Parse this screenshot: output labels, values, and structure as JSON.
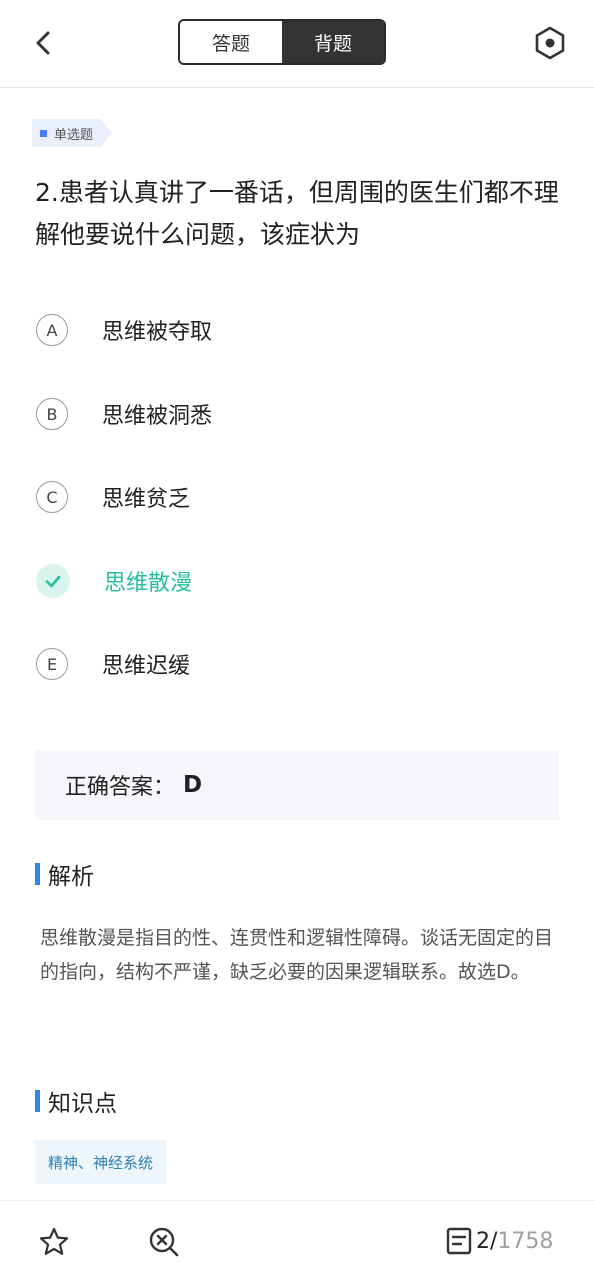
{
  "header": {
    "tabs": [
      {
        "label": "答题",
        "active": false
      },
      {
        "label": "背题",
        "active": true
      }
    ]
  },
  "question": {
    "type_label": "单选题",
    "text": "2.患者认真讲了一番话，但周围的医生们都不理解他要说什么问题，该症状为",
    "options": [
      {
        "letter": "A",
        "text": "思维被夺取",
        "correct": false
      },
      {
        "letter": "B",
        "text": "思维被洞悉",
        "correct": false
      },
      {
        "letter": "C",
        "text": "思维贫乏",
        "correct": false
      },
      {
        "letter": "D",
        "text": "思维散漫",
        "correct": true
      },
      {
        "letter": "E",
        "text": "思维迟缓",
        "correct": false
      }
    ]
  },
  "answer": {
    "label": "正确答案：",
    "value": "D"
  },
  "analysis": {
    "title": "解析",
    "text": "思维散漫是指目的性、连贯性和逻辑性障碍。谈话无固定的目的指向，结构不严谨，缺乏必要的因果逻辑联系。故选D。"
  },
  "knowledge": {
    "title": "知识点",
    "tags": [
      "精神、神经系统"
    ]
  },
  "footer": {
    "current": "2/",
    "total": "1758"
  },
  "colors": {
    "accent_blue": "#2e86e8",
    "correct_green": "#26c09b",
    "tag_blue": "#4a7ef0"
  },
  "icons": [
    "back-arrow-icon",
    "settings-hexagon-icon",
    "star-icon",
    "error-search-icon",
    "list-icon",
    "check-icon"
  ]
}
